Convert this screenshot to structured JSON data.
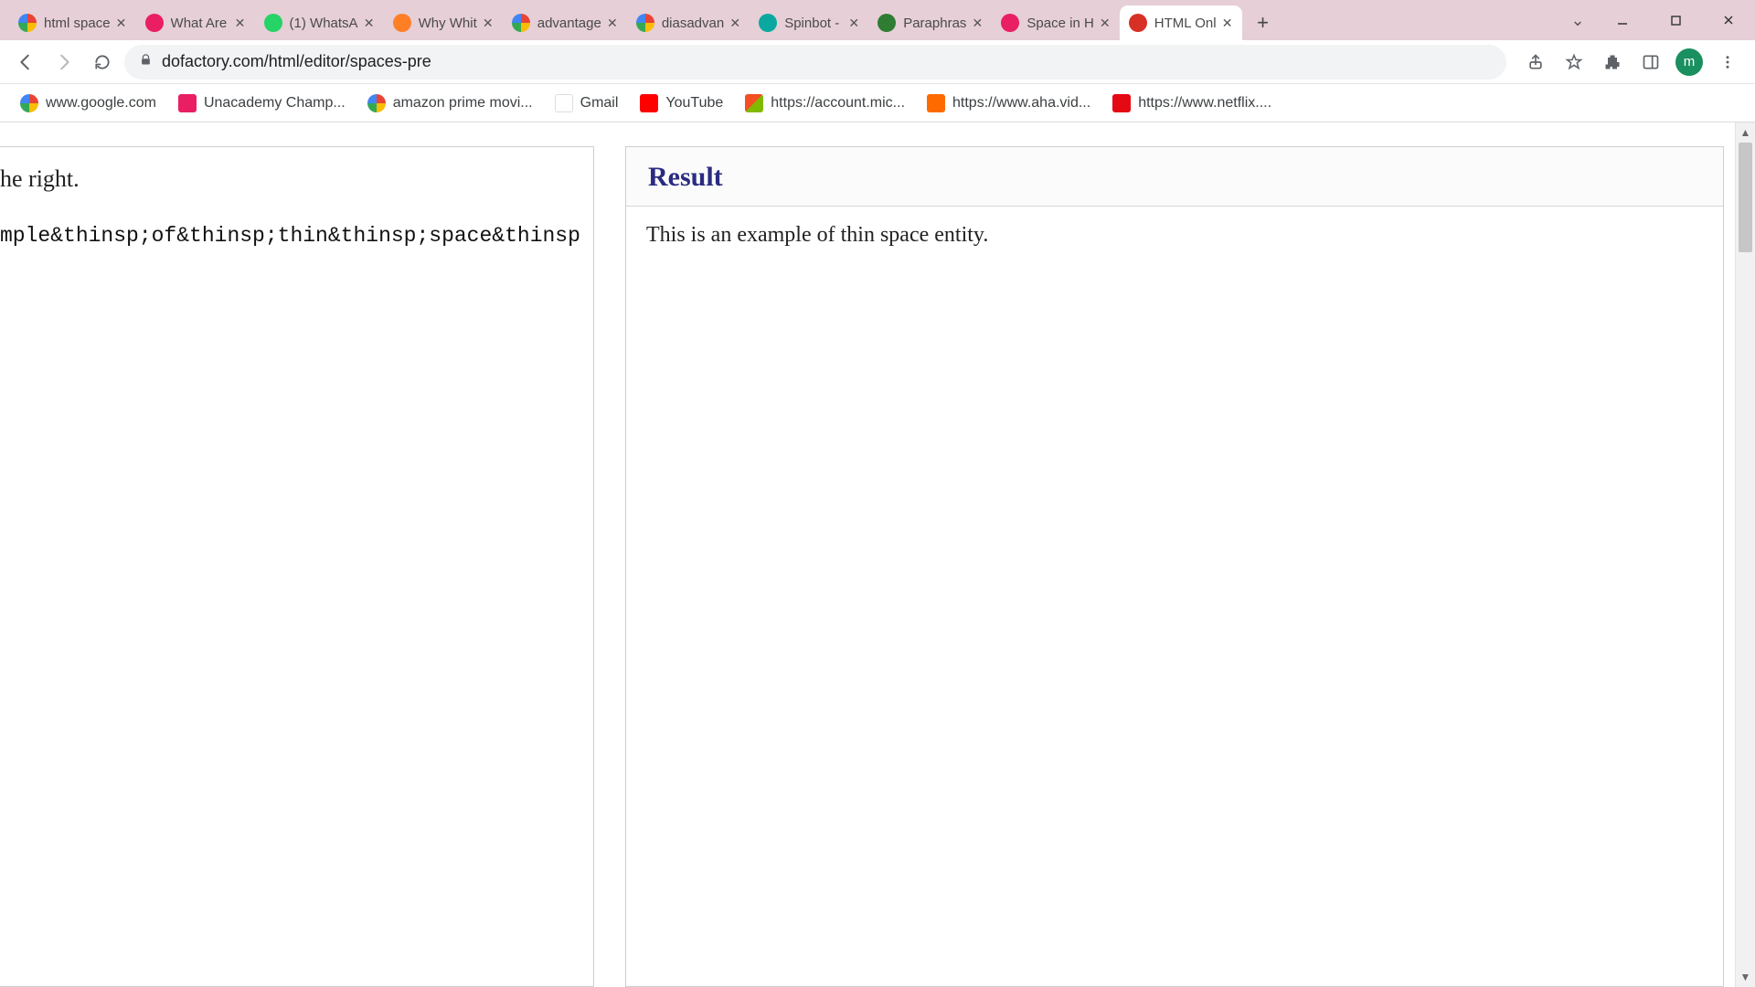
{
  "browser": {
    "tabs": [
      {
        "title": "html space",
        "favicon": "google"
      },
      {
        "title": "What Are",
        "favicon": "pink"
      },
      {
        "title": "(1) WhatsA",
        "favicon": "green"
      },
      {
        "title": "Why Whit",
        "favicon": "orange"
      },
      {
        "title": "advantage",
        "favicon": "google"
      },
      {
        "title": "diasadvan",
        "favicon": "google"
      },
      {
        "title": "Spinbot -",
        "favicon": "teal"
      },
      {
        "title": "Paraphras",
        "favicon": "greenbox"
      },
      {
        "title": "Space in H",
        "favicon": "pink"
      },
      {
        "title": "HTML Onl",
        "favicon": "red",
        "active": true
      }
    ],
    "url": "dofactory.com/html/editor/spaces-pre",
    "avatar_initial": "m"
  },
  "bookmarks": [
    {
      "label": "www.google.com",
      "icon": "google"
    },
    {
      "label": "Unacademy Champ...",
      "icon": "pink"
    },
    {
      "label": "amazon prime movi...",
      "icon": "google"
    },
    {
      "label": "Gmail",
      "icon": "gmail"
    },
    {
      "label": "YouTube",
      "icon": "yt"
    },
    {
      "label": "https://account.mic...",
      "icon": "ms"
    },
    {
      "label": "https://www.aha.vid...",
      "icon": "aha"
    },
    {
      "label": "https://www.netflix....",
      "icon": "netflix"
    }
  ],
  "editor": {
    "hint_fragment": "he right.",
    "code_fragment": "mple&thinsp;of&thinsp;thin&thinsp;space&thinsp"
  },
  "result": {
    "heading": "Result",
    "output_text": "This is an example of thin space entity."
  }
}
